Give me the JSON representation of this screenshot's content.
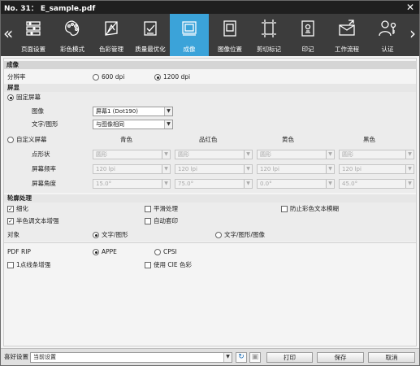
{
  "window": {
    "title": "No. 31： E_sample.pdf"
  },
  "toolbar": {
    "tabs": [
      {
        "label": "页面设置",
        "icon": "page-setup-icon"
      },
      {
        "label": "彩色模式",
        "icon": "palette-icon"
      },
      {
        "label": "色彩管理",
        "icon": "color-management-icon"
      },
      {
        "label": "质量最优化",
        "icon": "quality-check-icon"
      },
      {
        "label": "成像",
        "icon": "imaging-icon"
      },
      {
        "label": "图像位置",
        "icon": "image-position-icon"
      },
      {
        "label": "剪切标记",
        "icon": "crop-marks-icon"
      },
      {
        "label": "印记",
        "icon": "stamp-icon"
      },
      {
        "label": "工作流程",
        "icon": "workflow-icon"
      },
      {
        "label": "认证",
        "icon": "authentication-icon"
      }
    ],
    "active_tab": "成像"
  },
  "imaging": {
    "section_title": "成像",
    "resolution": {
      "label": "分辨率",
      "options": [
        "600 dpi",
        "1200 dpi"
      ],
      "selected": "1200 dpi"
    },
    "screen": {
      "title": "屏显",
      "fixed_label": "固定屏幕",
      "image_label": "图像",
      "image_value": "屏幕1 (Dot190)",
      "text_label": "文字/图形",
      "text_value": "与图像相同",
      "custom_label": "自定义屏幕",
      "columns": [
        "青色",
        "品红色",
        "黄色",
        "黑色"
      ],
      "rows": [
        {
          "label": "点形状",
          "values": [
            "圆形",
            "圆形",
            "圆形",
            "圆形"
          ]
        },
        {
          "label": "屏幕频率",
          "values": [
            "120 lpi",
            "120 lpi",
            "120 lpi",
            "120 lpi"
          ]
        },
        {
          "label": "屏幕角度",
          "values": [
            "15.0°",
            "75.0°",
            "0.0°",
            "45.0°"
          ]
        }
      ]
    },
    "contour": {
      "title": "轮廓处理",
      "thinning": "细化",
      "thinning_checked": "✓",
      "smoothing": "平滑处理",
      "anti_blur": "防止彩色文本模糊",
      "halftone_text": "半色调文本增强",
      "halftone_checked": "✓",
      "auto_trap": "自动套印",
      "target_label": "对象",
      "target_options": [
        "文字/图形",
        "文字/图形/图像"
      ],
      "target_selected": "文字/图形"
    },
    "pdf_rip": {
      "label": "PDF RIP",
      "options": [
        "APPE",
        "CPSI"
      ],
      "selected": "APPE"
    },
    "one_dot_line": "1点线条增强",
    "cie_color": "使用 CIE 色彩"
  },
  "bottom": {
    "favorites_label": "喜好设置",
    "favorites_value": "当前设置",
    "print_button": "打印",
    "save_button": "保存",
    "cancel_button": "取消"
  },
  "colors": {
    "titlebar": "#1f1f1f",
    "toolbar": "#3c3c3c",
    "active_tab": "#3ba3d9",
    "section": "#d5d5d5"
  }
}
